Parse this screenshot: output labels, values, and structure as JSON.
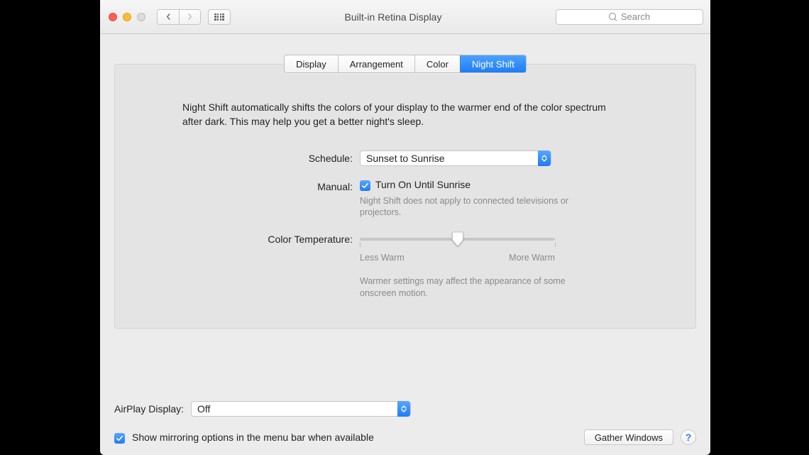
{
  "window": {
    "title": "Built-in Retina Display"
  },
  "search": {
    "placeholder": "Search"
  },
  "tabs": {
    "display": "Display",
    "arrangement": "Arrangement",
    "color": "Color",
    "night_shift": "Night Shift"
  },
  "night_shift": {
    "intro": "Night Shift automatically shifts the colors of your display to the warmer end of the color spectrum after dark. This may help you get a better night's sleep.",
    "schedule_label": "Schedule:",
    "schedule_value": "Sunset to Sunrise",
    "manual_label": "Manual:",
    "manual_checkbox": "Turn On Until Sunrise",
    "manual_hint": "Night Shift does not apply to connected televisions or projectors.",
    "temp_label": "Color Temperature:",
    "temp_less": "Less Warm",
    "temp_more": "More Warm",
    "temp_hint": "Warmer settings may affect the appearance of some onscreen motion."
  },
  "airplay": {
    "label": "AirPlay Display:",
    "value": "Off"
  },
  "mirroring": {
    "label": "Show mirroring options in the menu bar when available"
  },
  "buttons": {
    "gather": "Gather Windows"
  }
}
